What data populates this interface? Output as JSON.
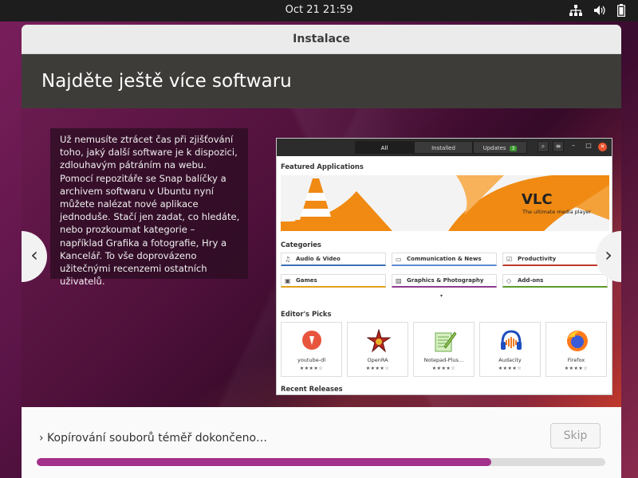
{
  "topbar": {
    "clock": "Oct 21  21:59"
  },
  "window": {
    "title": "Instalace",
    "heading": "Najděte ještě více softwaru",
    "description": "Už nemusíte ztrácet čas při zjišťování toho, jaký další software je k dispozici, zdlouhavým pátráním na webu. Pomocí repozitáře se Snap balíčky a archivem softwaru v Ubuntu nyní můžete nalézat nové aplikace jednoduše. Stačí jen zadat, co hledáte, nebo prozkoumat kategorie – například Grafika a fotografie, Hry a Kancelář. To vše doprovázeno užitečnými recenzemi ostatních uživatelů.",
    "prev_label": "‹",
    "next_label": "›",
    "status_text": "› Kopírování souborů téměř dokončeno…",
    "skip_label": "Skip",
    "progress": 0.8
  },
  "software_center": {
    "tabs": [
      "All",
      "Installed",
      "Updates"
    ],
    "updates_count": "3",
    "featured_heading": "Featured Applications",
    "banner_title": "VLC",
    "banner_subtitle": "The ultimate media player",
    "categories_heading": "Categories",
    "categories": [
      {
        "label": "Audio & Video",
        "color": "#3b6fb6",
        "icon": "music-note-icon"
      },
      {
        "label": "Communication & News",
        "color": "#5b8bd0",
        "icon": "chat-icon"
      },
      {
        "label": "Productivity",
        "color": "#c0392b",
        "icon": "check-icon"
      },
      {
        "label": "Games",
        "color": "#e0a21a",
        "icon": "gamepad-icon"
      },
      {
        "label": "Graphics & Photography",
        "color": "#8e3a8e",
        "icon": "image-icon"
      },
      {
        "label": "Add-ons",
        "color": "#5a9a2a",
        "icon": "puzzle-icon"
      }
    ],
    "picks_heading": "Editor's Picks",
    "picks": [
      {
        "name": "youtube-dl",
        "stars": "★★★★☆"
      },
      {
        "name": "OpenRA",
        "stars": "★★★★☆"
      },
      {
        "name": "Notepad-Plus…",
        "stars": "★★★★☆"
      },
      {
        "name": "Audacity",
        "stars": "★★★★☆"
      },
      {
        "name": "Firefox",
        "stars": "★★★★☆"
      }
    ],
    "recent_heading": "Recent Releases"
  }
}
